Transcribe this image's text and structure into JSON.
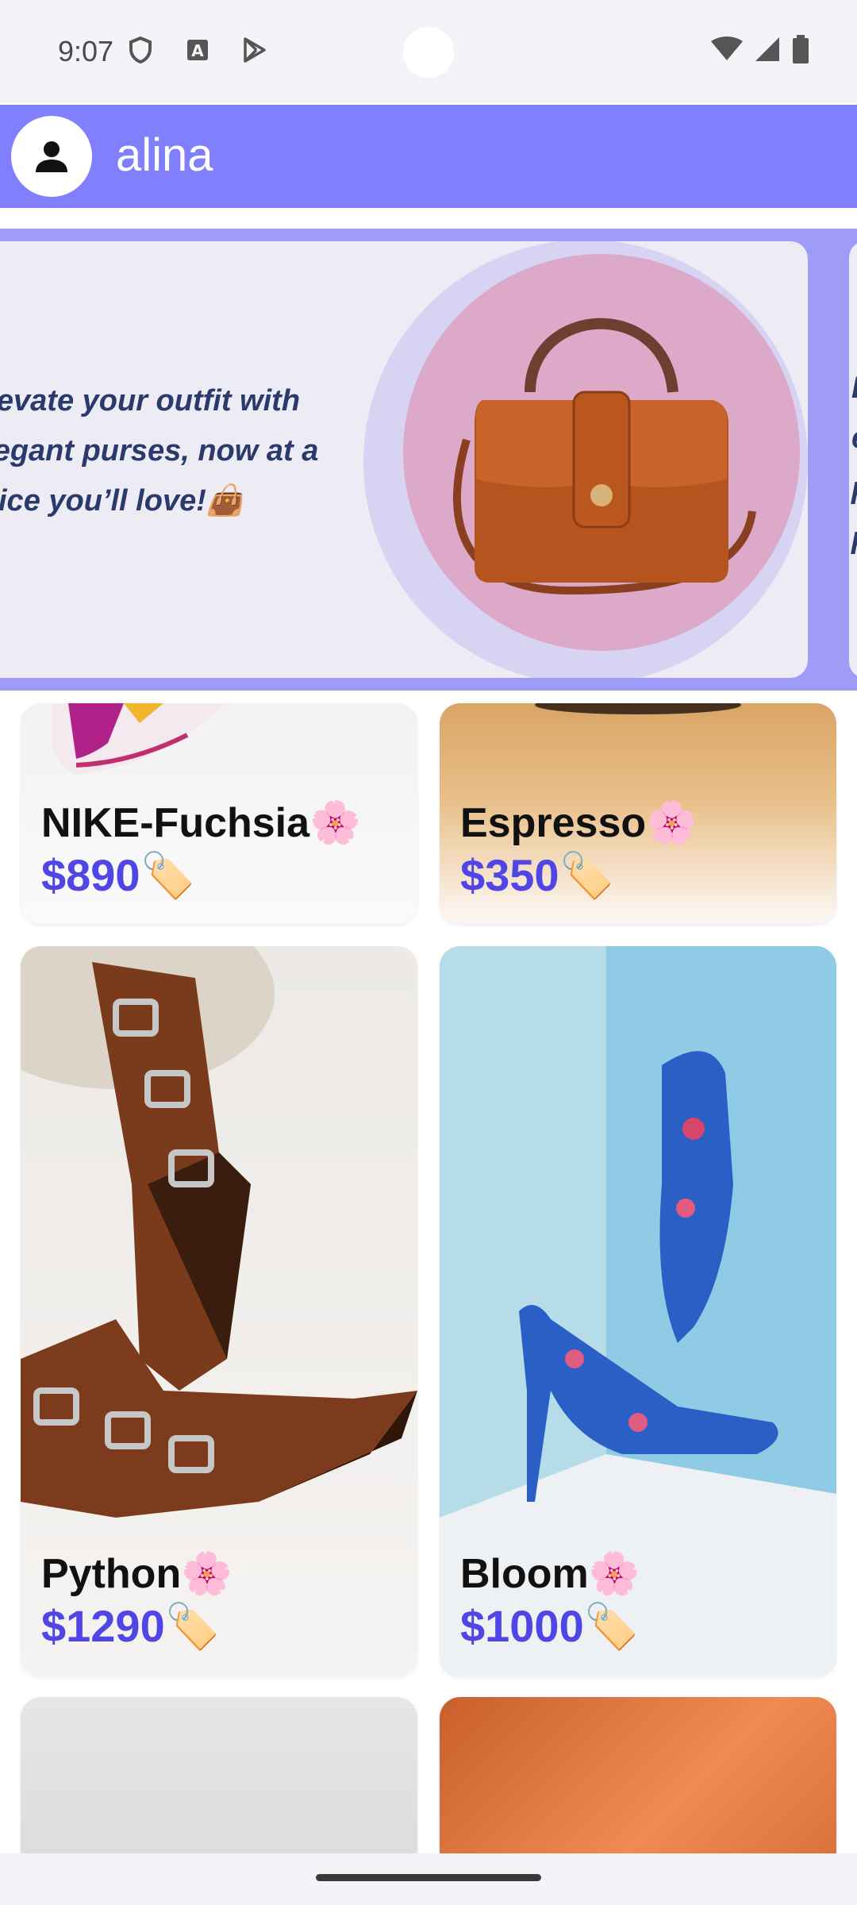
{
  "status_bar": {
    "time": "9:07",
    "left_icons": [
      "shield-icon",
      "font-a-icon",
      "play-store-icon"
    ],
    "right_icons": [
      "wifi-icon",
      "signal-icon",
      "battery-icon"
    ]
  },
  "header": {
    "avatar_icon": "person-icon",
    "username": "alina",
    "background": "#8080ff"
  },
  "banner": {
    "lines": [
      "Elevate your outfit with",
      "elegant purses, now at a",
      "price you’ll love!👜"
    ],
    "next_partial_lines": [
      "E",
      "e",
      "p",
      "p"
    ],
    "image": "brown-handbag"
  },
  "products": [
    {
      "title": "NIKE-Fuchsia🌸",
      "price": "$890🏷️"
    },
    {
      "title": "Espresso🌸",
      "price": "$350🏷️"
    },
    {
      "title": "Python🌸",
      "price": "$1290🏷️"
    },
    {
      "title": "Bloom🌸",
      "price": "$1000🏷️"
    }
  ],
  "colors": {
    "accent": "#4f46e5",
    "banner_text": "#2b3a6c"
  }
}
